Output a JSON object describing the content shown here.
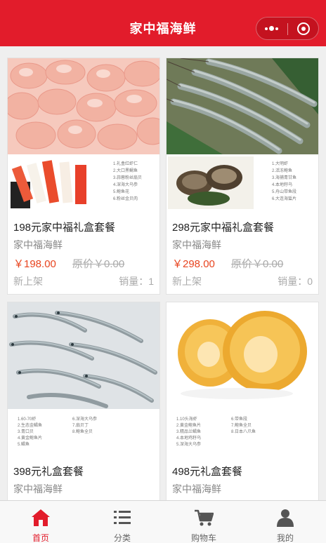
{
  "header": {
    "title": "家中福海鲜"
  },
  "products": [
    {
      "name": "198元家中福礼盒套餐",
      "shop": "家中福海鲜",
      "price": "￥198.00",
      "original_price": "原价￥0.00",
      "tag": "新上架",
      "sales": "销量：1",
      "image": {
        "kind": "shrimp-meat",
        "list": [
          "1.礼盒红虾仁",
          "2.大口黑鲷鱼",
          "3.蒜蓉粉丝扇贝",
          "4.深海大乌参",
          "5.鲍鱼花",
          "6.粉丝金贝肉"
        ]
      }
    },
    {
      "name": "298元家中福礼盒套餐",
      "shop": "家中福海鲜",
      "price": "￥298.00",
      "original_price": "原价￥0.00",
      "tag": "新上架",
      "sales": "销量：0",
      "image": {
        "kind": "prawns",
        "list": [
          "1.大明虾",
          "2.活冻鲍鱼",
          "3.海捕青甘鱼",
          "4.本地籽乌",
          "5.舟山带鱼段",
          "6.大连海蜇片"
        ]
      }
    },
    {
      "name": "398元礼盒套餐",
      "shop": "家中福海鲜",
      "image": {
        "kind": "river-shrimp",
        "list": [
          "1.60-70虾",
          "2.生态金鲳鱼",
          "3.青口贝",
          "4.黄金鲍鱼片",
          "5.鲳鱼",
          "6.深海大乌参",
          "7.扇贝丁",
          "8.鲍鱼全贝"
        ]
      }
    },
    {
      "name": "498元礼盒套餐",
      "shop": "家中福海鲜",
      "image": {
        "kind": "abalone",
        "list": [
          "1.10头海虾",
          "2.黄金鲍鱼片",
          "3.精品兰鲳鱼",
          "4.本地鸡籽乌",
          "5.深海大乌参",
          "6.带鱼段",
          "7.鲍鱼全贝",
          "8.日本八爪鱼"
        ]
      }
    }
  ],
  "tabbar": [
    {
      "label": "首页",
      "icon": "home-icon",
      "active": true
    },
    {
      "label": "分类",
      "icon": "list-icon",
      "active": false
    },
    {
      "label": "购物车",
      "icon": "cart-icon",
      "active": false
    },
    {
      "label": "我的",
      "icon": "person-icon",
      "active": false
    }
  ],
  "colors": {
    "brand": "#e21c2b",
    "price": "#e8441f"
  }
}
